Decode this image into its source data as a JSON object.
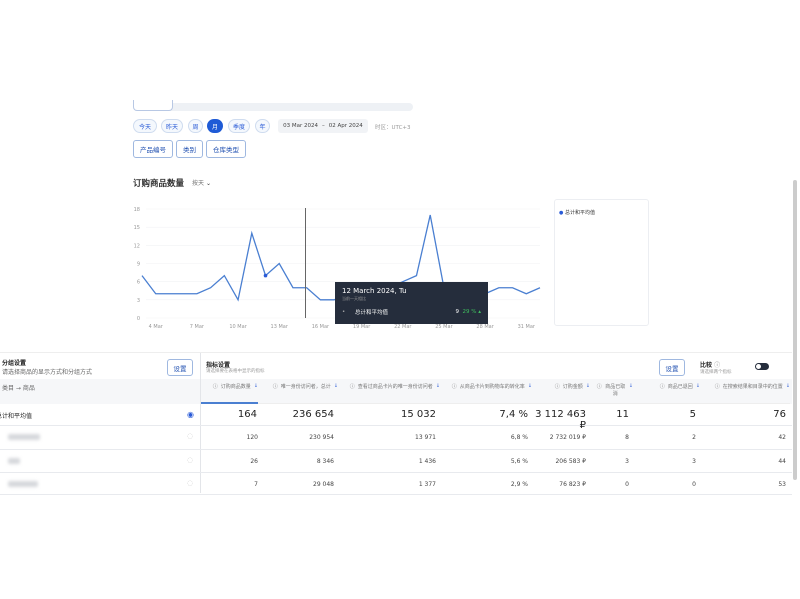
{
  "periods": [
    "今天",
    "昨天",
    "周",
    "月",
    "季度",
    "年"
  ],
  "active_period": "月",
  "date_from": "03 Mar 2024",
  "date_sep": "–",
  "date_to": "02 Apr 2024",
  "timezone": "时区：UTC+3",
  "filters": [
    "产品编号",
    "类别",
    "仓库类型"
  ],
  "chart_title": "订购商品数量",
  "chart_group": "按天",
  "legend": "总计和平均值",
  "tooltip": {
    "date": "12 March 2024, Tu",
    "sub": "当前一天相比",
    "series": "总计和平均值",
    "value": "9",
    "change": "29 %"
  },
  "chart_data": {
    "type": "line",
    "title": "订购商品数量",
    "x_ticks": [
      "4 Mar",
      "7 Mar",
      "10 Mar",
      "13 Mar",
      "16 Mar",
      "19 Mar",
      "22 Mar",
      "25 Mar",
      "28 Mar",
      "31 Mar"
    ],
    "y_ticks": [
      0,
      3,
      6,
      9,
      12,
      15,
      18
    ],
    "ylim": [
      0,
      18
    ],
    "x_start_day": 3,
    "series": [
      {
        "name": "总计和平均值",
        "color": "#4a7fd1",
        "values": [
          7,
          4,
          4,
          4,
          4,
          5,
          7,
          3,
          14,
          7,
          9,
          5,
          5,
          3,
          3,
          4,
          5,
          5,
          5,
          6,
          7,
          17,
          5,
          1,
          5,
          4,
          5,
          5,
          4,
          5
        ]
      }
    ]
  },
  "left_panel": {
    "title": "分组设置",
    "subtitle": "请选择商品的显示方式和分组方式",
    "button": "设置",
    "col_header": "类目 → 商品",
    "total_label": "总计和平均值"
  },
  "metrics": {
    "title": "指标设置",
    "subtitle": "请选择要在表格中显示的指标",
    "button": "设置",
    "compare_label": "比较",
    "compare_sub": "请选择两个指标"
  },
  "columns": [
    "订购商品数量",
    "唯一身份访问者，总计",
    "查看过商品卡片的唯一身份访问者",
    "从商品卡片到购物车的转化率",
    "订购金额",
    "商品已取消",
    "商品已退回",
    "在搜索结果和目录中的位置"
  ],
  "rows": [
    [
      "164",
      "236 654",
      "15 032",
      "7,4 %",
      "3 112 463 ₽",
      "11",
      "5",
      "76"
    ],
    [
      "120",
      "230 954",
      "13 971",
      "6,8 %",
      "2 732 019 ₽",
      "8",
      "2",
      "42"
    ],
    [
      "26",
      "8 346",
      "1 436",
      "5,6 %",
      "206 583 ₽",
      "3",
      "3",
      "44"
    ],
    [
      "7",
      "29 048",
      "1 377",
      "2,9 %",
      "76 823 ₽",
      "0",
      "0",
      "53"
    ]
  ]
}
